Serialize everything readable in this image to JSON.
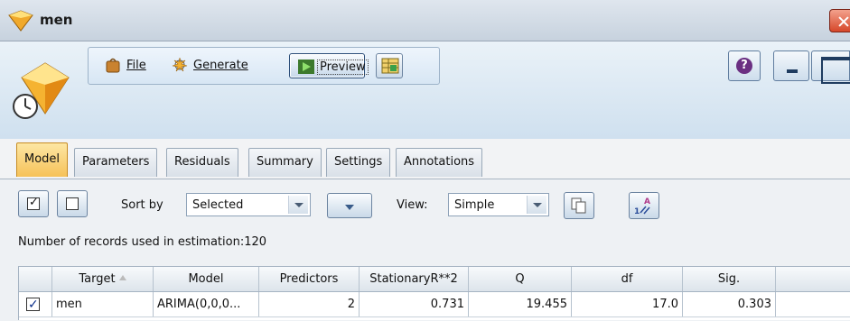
{
  "window": {
    "title": "men"
  },
  "toolbar": {
    "file_label": "File",
    "generate_label": "Generate",
    "preview_label": "Preview"
  },
  "tabs": [
    {
      "label": "Model",
      "active": true
    },
    {
      "label": "Parameters"
    },
    {
      "label": "Residuals"
    },
    {
      "label": "Summary"
    },
    {
      "label": "Settings"
    },
    {
      "label": "Annotations"
    }
  ],
  "controls": {
    "sort_label": "Sort by",
    "sort_value": "Selected",
    "view_label": "View:",
    "view_value": "Simple"
  },
  "records_text": "Number of records used in estimation:120",
  "table": {
    "columns": [
      "Target",
      "Model",
      "Predictors",
      "StationaryR**2",
      "Q",
      "df",
      "Sig."
    ],
    "rows": [
      {
        "checked": true,
        "cells": [
          "men",
          "ARIMA(0,0,0...",
          "2",
          "0.731",
          "19.455",
          "17.0",
          "0.303"
        ]
      }
    ]
  },
  "colors": {
    "active_tab": "#f6c259",
    "accent": "#2d4f7a",
    "help": "#6b2f82"
  }
}
